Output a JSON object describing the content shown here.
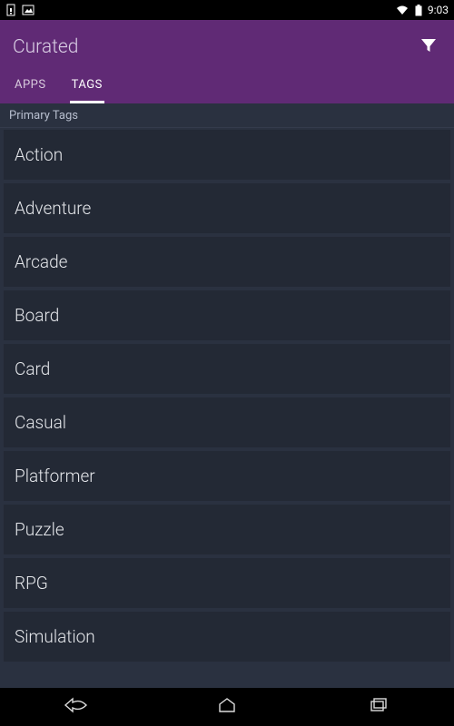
{
  "status": {
    "time": "9:03"
  },
  "header": {
    "title": "Curated"
  },
  "tabs": [
    {
      "label": "APPS",
      "active": false
    },
    {
      "label": "TAGS",
      "active": true
    }
  ],
  "section": {
    "header": "Primary Tags"
  },
  "tags": [
    "Action",
    "Adventure",
    "Arcade",
    "Board",
    "Card",
    "Casual",
    "Platformer",
    "Puzzle",
    "RPG",
    "Simulation"
  ]
}
